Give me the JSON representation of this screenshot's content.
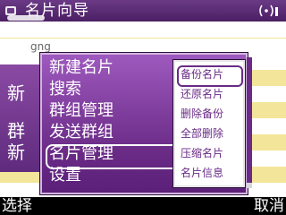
{
  "status_bar": {
    "title": "名片向导"
  },
  "list": {
    "search_text": "gng",
    "ghost_labels": [
      "新",
      "群",
      "新"
    ]
  },
  "menu": {
    "items": [
      "新建名片",
      "搜索",
      "群组管理",
      "发送群组",
      "名片管理",
      "设置"
    ],
    "selected_index": 4
  },
  "submenu": {
    "items": [
      "备份名片",
      "还原名片",
      "删除备份",
      "全部删除",
      "压缩名片",
      "名片信息"
    ],
    "selected_index": 0
  },
  "softkeys": {
    "left": "选择",
    "right": "取消"
  }
}
